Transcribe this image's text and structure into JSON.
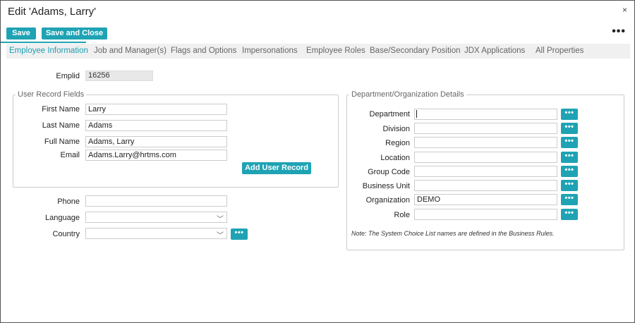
{
  "title": "Edit 'Adams, Larry'",
  "close_icon": "×",
  "more_icon": "•••",
  "toolbar": {
    "save": "Save",
    "save_close": "Save and Close"
  },
  "tabs": [
    {
      "label": "Employee Information",
      "active": true
    },
    {
      "label": "Job and Manager(s)"
    },
    {
      "label": "Flags and Options"
    },
    {
      "label": "Impersonations"
    },
    {
      "label": "Employee Roles"
    },
    {
      "label": "Base/Secondary Position"
    },
    {
      "label": "JDX Applications"
    },
    {
      "label": "All Properties"
    }
  ],
  "emplid": {
    "label": "Emplid",
    "value": "16256"
  },
  "user_record": {
    "legend": "User Record Fields",
    "first_name": {
      "label": "First Name",
      "value": "Larry"
    },
    "last_name": {
      "label": "Last Name",
      "value": "Adams"
    },
    "full_name": {
      "label": "Full Name",
      "value": "Adams, Larry"
    },
    "email": {
      "label": "Email",
      "value": "Adams.Larry@hrtms.com"
    },
    "add_button": "Add User Record"
  },
  "phone": {
    "label": "Phone",
    "value": ""
  },
  "language": {
    "label": "Language",
    "value": ""
  },
  "country": {
    "label": "Country",
    "value": ""
  },
  "dots_label": "•••",
  "chevron": "﹀",
  "dept": {
    "legend": "Department/Organization Details",
    "department": {
      "label": "Department",
      "value": ""
    },
    "division": {
      "label": "Division",
      "value": ""
    },
    "region": {
      "label": "Region",
      "value": ""
    },
    "location": {
      "label": "Location",
      "value": ""
    },
    "group_code": {
      "label": "Group Code",
      "value": ""
    },
    "business_unit": {
      "label": "Business Unit",
      "value": ""
    },
    "organization": {
      "label": "Organization",
      "value": "DEMO"
    },
    "role": {
      "label": "Role",
      "value": ""
    },
    "note": "Note: The System Choice List names are defined in the Business Rules."
  },
  "colors": {
    "accent": "#1fa3b4",
    "tab_active": "#1a9fb2"
  }
}
